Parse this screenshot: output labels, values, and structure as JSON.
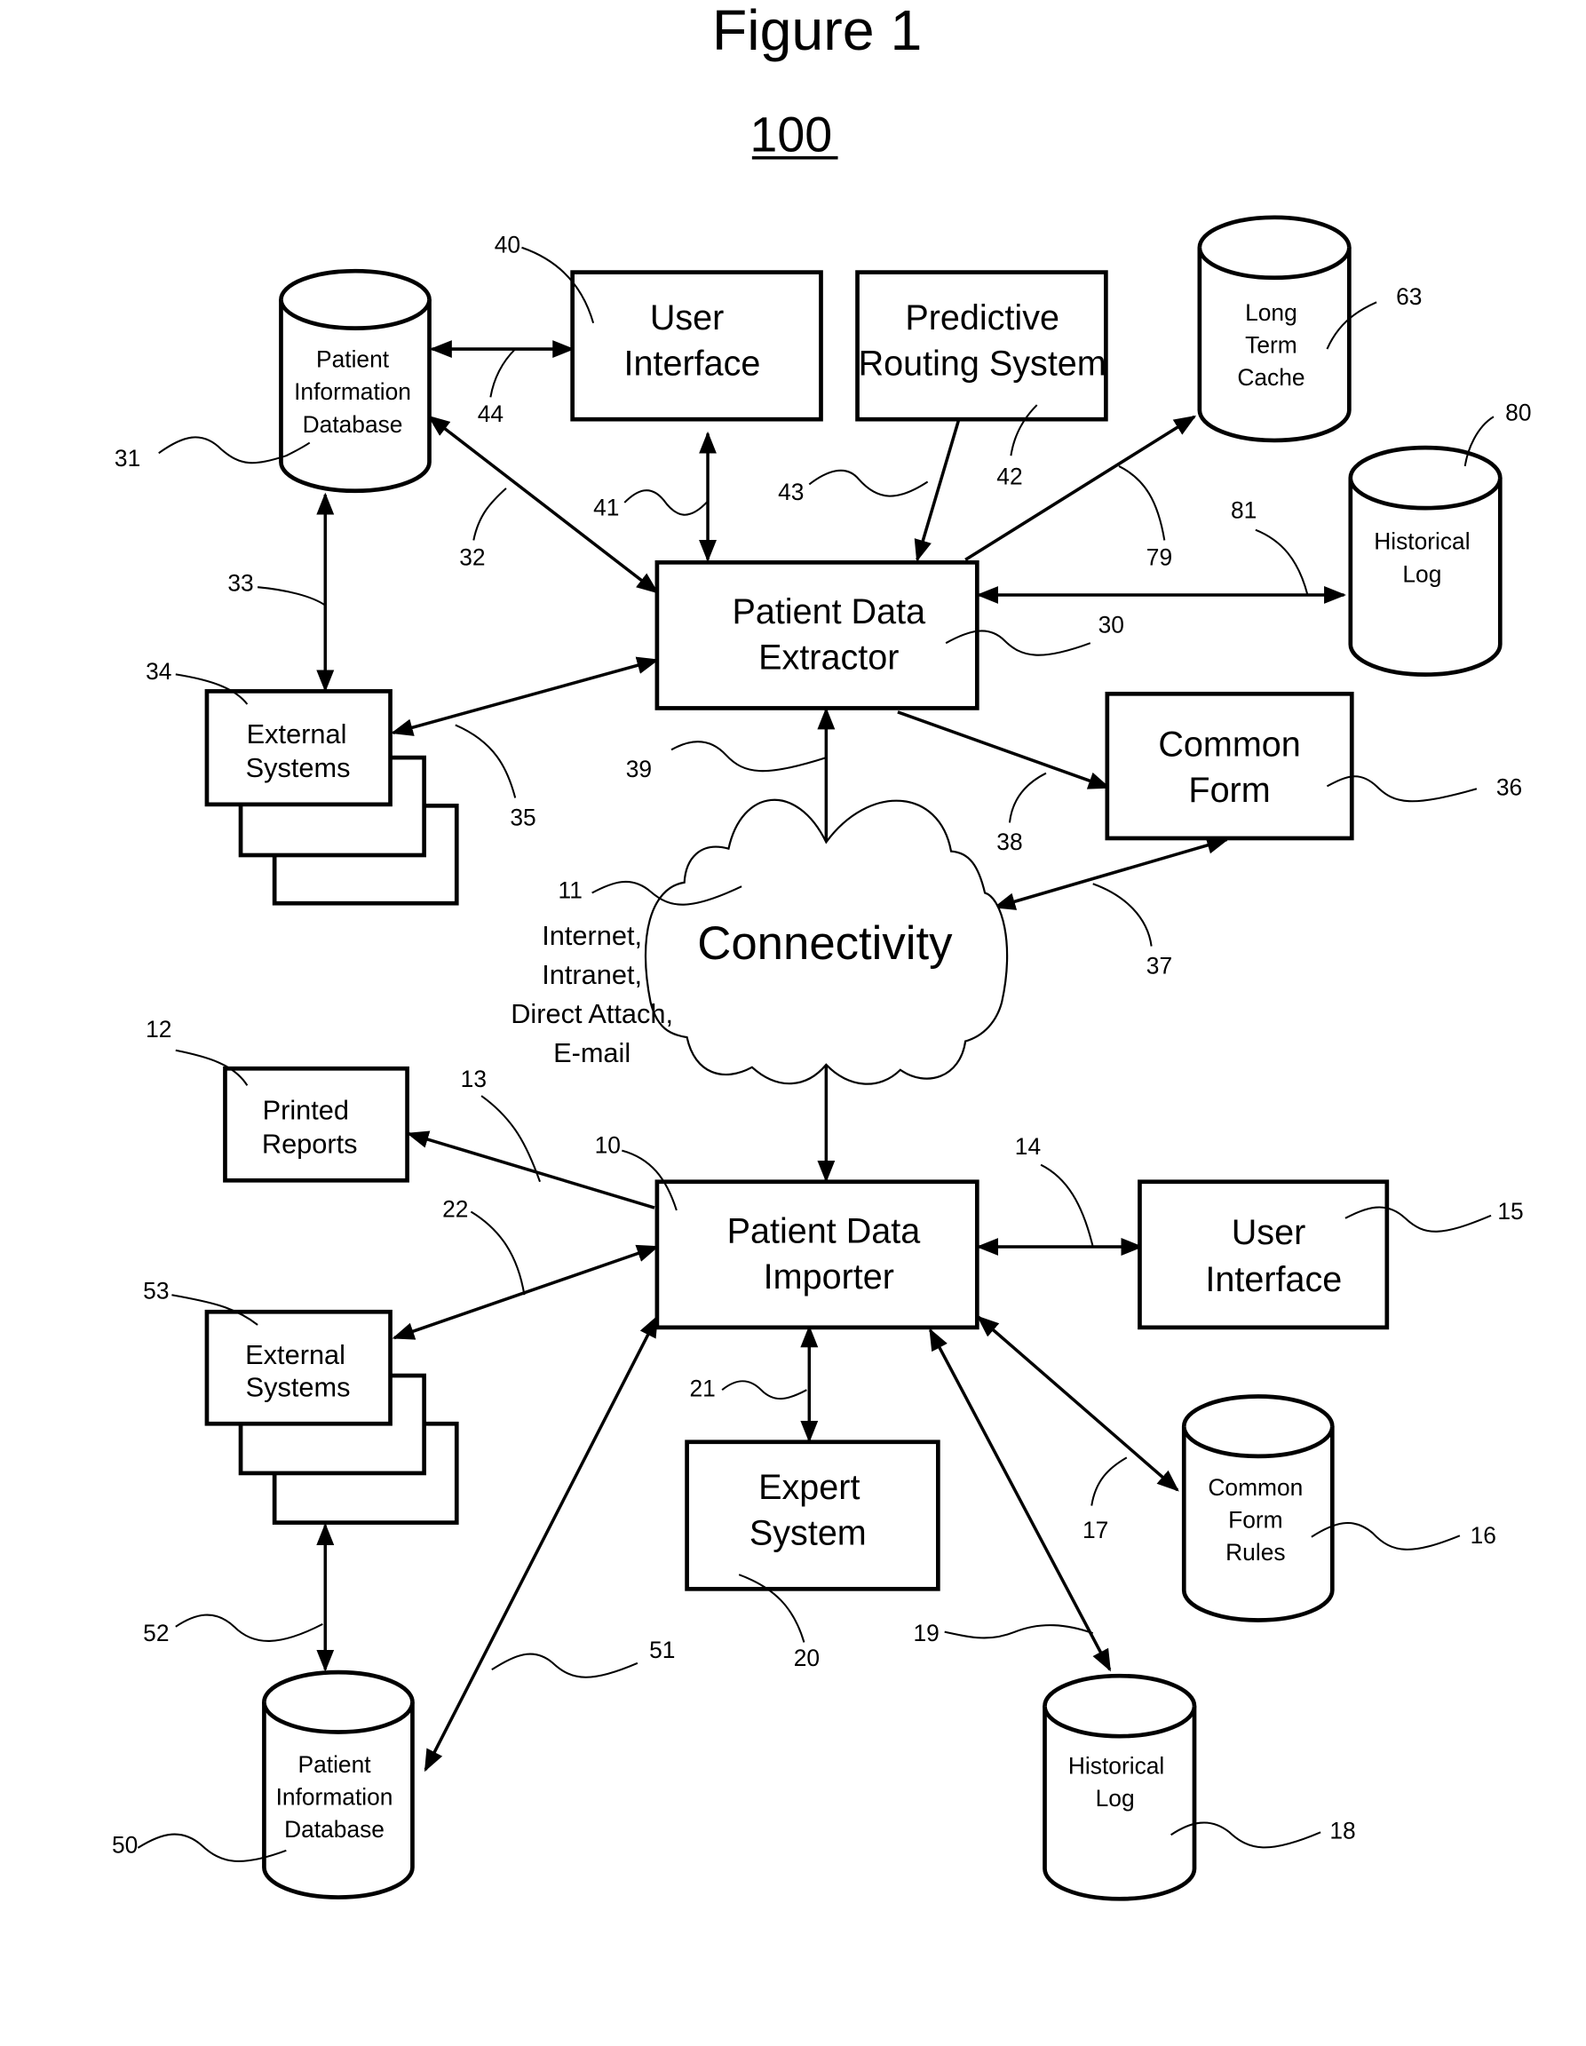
{
  "figure": {
    "title": "Figure 1",
    "number": "100"
  },
  "components": {
    "user_interface_top": {
      "ref": "40",
      "lines": [
        "User",
        "Interface"
      ]
    },
    "predictive_routing": {
      "ref": "42",
      "lines": [
        "Predictive",
        "Routing System"
      ]
    },
    "long_term_cache": {
      "ref": "63",
      "lines": [
        "Long",
        "Term",
        "Cache"
      ]
    },
    "historical_log_top": {
      "ref": "80",
      "lines": [
        "Historical",
        "Log"
      ]
    },
    "patient_db_top": {
      "ref": "31",
      "lines": [
        "Patient",
        "Information",
        "Database"
      ]
    },
    "extractor": {
      "ref": "30",
      "lines": [
        "Patient Data",
        "Extractor"
      ]
    },
    "external_top": {
      "ref": "34",
      "lines": [
        "External",
        "Systems"
      ]
    },
    "common_form": {
      "ref": "36",
      "lines": [
        "Common",
        "Form"
      ]
    },
    "connectivity": {
      "ref": "11",
      "label": "Connectivity",
      "media": [
        "Internet,",
        "Intranet,",
        "Direct Attach,",
        "E-mail"
      ]
    },
    "printed_reports": {
      "ref": "12",
      "lines": [
        "Printed",
        "Reports"
      ]
    },
    "importer": {
      "ref": "10",
      "lines": [
        "Patient Data",
        "Importer"
      ]
    },
    "user_interface_bottom": {
      "ref": "15",
      "lines": [
        "User",
        "Interface"
      ]
    },
    "external_bottom": {
      "ref": "53",
      "lines": [
        "External",
        "Systems"
      ]
    },
    "expert_system": {
      "ref": "20",
      "lines": [
        "Expert",
        "System"
      ]
    },
    "common_form_rules": {
      "ref": "16",
      "lines": [
        "Common",
        "Form",
        "Rules"
      ]
    },
    "patient_db_bottom": {
      "ref": "50",
      "lines": [
        "Patient",
        "Information",
        "Database"
      ]
    },
    "historical_log_bottom": {
      "ref": "18",
      "lines": [
        "Historical",
        "Log"
      ]
    }
  },
  "connections": {
    "c44": "44",
    "c41": "41",
    "c43": "43",
    "c32": "32",
    "c33": "33",
    "c35": "35",
    "c79": "79",
    "c81": "81",
    "c39": "39",
    "c38": "38",
    "c37": "37",
    "c13": "13",
    "c22": "22",
    "c14": "14",
    "c21": "21",
    "c17": "17",
    "c19": "19",
    "c51": "51",
    "c52": "52"
  }
}
